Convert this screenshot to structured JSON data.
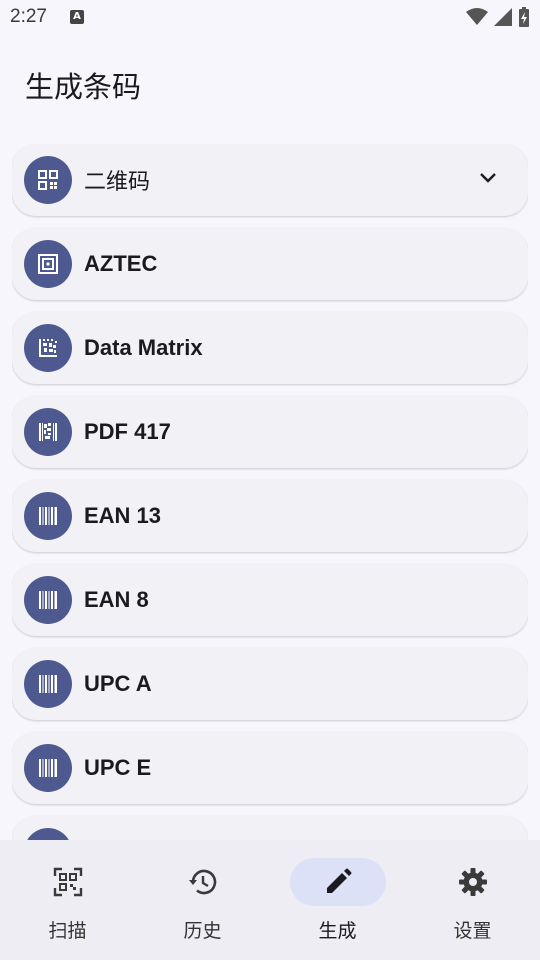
{
  "status_bar": {
    "time": "2:27",
    "notification_letter": "A"
  },
  "header": {
    "title": "生成条码"
  },
  "barcode_types": [
    {
      "label": "二维码",
      "icon": "qr-code-icon",
      "expandable": true
    },
    {
      "label": "AZTEC",
      "icon": "aztec-icon"
    },
    {
      "label": "Data Matrix",
      "icon": "data-matrix-icon"
    },
    {
      "label": "PDF 417",
      "icon": "pdf417-icon"
    },
    {
      "label": "EAN 13",
      "icon": "barcode-icon"
    },
    {
      "label": "EAN 8",
      "icon": "barcode-icon"
    },
    {
      "label": "UPC A",
      "icon": "barcode-icon"
    },
    {
      "label": "UPC E",
      "icon": "barcode-icon"
    }
  ],
  "bottom_nav": {
    "items": [
      {
        "label": "扫描",
        "icon": "scan-icon"
      },
      {
        "label": "历史",
        "icon": "history-icon"
      },
      {
        "label": "生成",
        "icon": "pencil-icon",
        "active": true
      },
      {
        "label": "设置",
        "icon": "gear-icon"
      }
    ]
  },
  "colors": {
    "accent": "#4e5a8f",
    "active_pill": "#dde1f8",
    "background": "#f7f6fc"
  }
}
